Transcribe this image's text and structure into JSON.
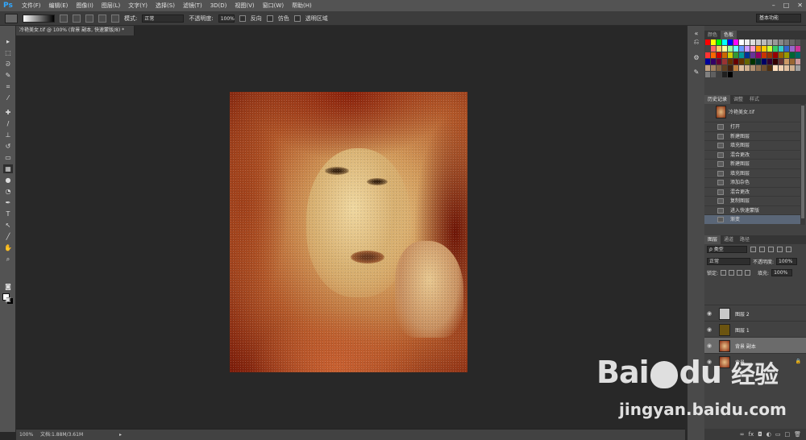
{
  "app": {
    "logo": "Ps"
  },
  "menu": [
    "文件(F)",
    "编辑(E)",
    "图像(I)",
    "图层(L)",
    "文字(Y)",
    "选择(S)",
    "滤镜(T)",
    "3D(D)",
    "视图(V)",
    "窗口(W)",
    "帮助(H)"
  ],
  "window_controls": [
    "–",
    "□",
    "✕"
  ],
  "options": {
    "mode_label": "模式:",
    "mode_value": "正常",
    "opacity_label": "不透明度:",
    "opacity_value": "100%",
    "reverse_label": "反向",
    "dither_label": "仿色",
    "transparency_label": "透明区域",
    "workspace": "基本功能"
  },
  "document": {
    "tab_title": "冷艳美女.tif @ 100% (背景 副本, 快速蒙版/8) *",
    "zoom": "100%",
    "doc_size": "文档:1.88M/3.61M"
  },
  "panels": {
    "swatch_tabs": [
      "颜色",
      "色板"
    ],
    "history_tabs": [
      "历史记录",
      "调整",
      "样式"
    ],
    "layers_tabs": [
      "图层",
      "通道",
      "路径"
    ]
  },
  "swatch_colors": [
    "#ff0000",
    "#ffff00",
    "#00ff00",
    "#00ffff",
    "#0000ff",
    "#ff00ff",
    "#ffffff",
    "#eeeeee",
    "#dddddd",
    "#cccccc",
    "#bbbbbb",
    "#aaaaaa",
    "#999999",
    "#888888",
    "#777777",
    "#666666",
    "#555555",
    "#444444",
    "#ff6666",
    "#ffcc66",
    "#ffff99",
    "#99ff99",
    "#66ffff",
    "#6699ff",
    "#cc99ff",
    "#ff99cc",
    "#ff9900",
    "#ffcc00",
    "#ccff33",
    "#33cc66",
    "#33cccc",
    "#3366cc",
    "#9966cc",
    "#cc3399",
    "#ff3333",
    "#ff6600",
    "#cc0000",
    "#cc6600",
    "#cccc00",
    "#339933",
    "#009999",
    "#003399",
    "#663399",
    "#990066",
    "#cc3300",
    "#993300",
    "#990000",
    "#996600",
    "#999900",
    "#006633",
    "#006666",
    "#000099",
    "#330066",
    "#660033",
    "#993333",
    "#663300",
    "#660000",
    "#663300",
    "#666600",
    "#003300",
    "#003333",
    "#000066",
    "#330033",
    "#330000",
    "#663333",
    "#cc9966",
    "#996633",
    "#cc9999",
    "#c0a080",
    "#a08060",
    "#806040",
    "#604020",
    "#402010",
    "#c08040",
    "#e0c0a0",
    "#d0b090",
    "#b09070",
    "#907050",
    "#705030",
    "#503010",
    "#ffe0c0",
    "#f0d0b0",
    "#e0c0a0",
    "#d0b090",
    "#a0a0a0",
    "#808080",
    "#606060",
    "#404040",
    "#202020",
    "#000000"
  ],
  "history": {
    "snapshot": "冷艳美女.tif",
    "items": [
      "打开",
      "新建图层",
      "填充图层",
      "混合更改",
      "新建图层",
      "填充图层",
      "添加杂色",
      "混合更改",
      "复制图层",
      "进入快速蒙版",
      "渐变"
    ]
  },
  "layers": {
    "filter_kind": "ρ 类型",
    "blend_mode": "正常",
    "opacity_label": "不透明度:",
    "opacity_value": "100%",
    "lock_label": "锁定:",
    "fill_label": "填充:",
    "fill_value": "100%",
    "items": [
      {
        "name": "图层 2",
        "thumb_color": "#c8c8c8"
      },
      {
        "name": "图层 1",
        "thumb_color": "#6b5410"
      },
      {
        "name": "背景 副本",
        "thumb_color": "photo"
      },
      {
        "name": "背景",
        "thumb_color": "photo"
      }
    ]
  },
  "watermark": {
    "logo_left": "Bai",
    "logo_right": "du",
    "logo_cn": "经验",
    "url": "jingyan.baidu.com"
  }
}
